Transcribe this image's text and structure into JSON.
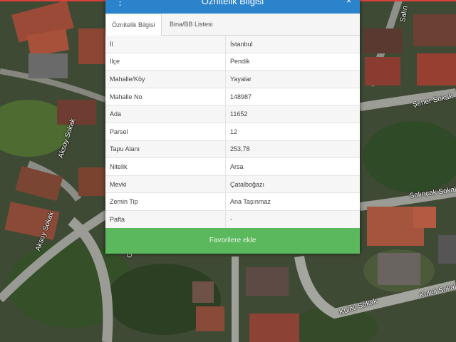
{
  "dialog": {
    "title": "Öznitelik Bilgisi",
    "close": "×",
    "menu": "⋮",
    "tabs": [
      {
        "label": "Öznitelik Bilgisi",
        "active": true
      },
      {
        "label": "Bina/BB Listesi",
        "active": false
      }
    ],
    "rows": [
      {
        "key": "İl",
        "value": "İstanbul"
      },
      {
        "key": "İlçe",
        "value": "Pendik"
      },
      {
        "key": "Mahalle/Köy",
        "value": "Yayalar"
      },
      {
        "key": "Mahalle No",
        "value": "148987"
      },
      {
        "key": "Ada",
        "value": "11652"
      },
      {
        "key": "Parsel",
        "value": "12"
      },
      {
        "key": "Tapu Alanı",
        "value": "253,78"
      },
      {
        "key": "Nitelik",
        "value": "Arsa"
      },
      {
        "key": "Mevki",
        "value": "Çatalboğazı"
      },
      {
        "key": "Zemin Tip",
        "value": "Ana Taşınmaz"
      },
      {
        "key": "Pafta",
        "value": "-"
      }
    ],
    "favorites_button": "Favorilere ekle"
  },
  "map": {
    "street_labels": {
      "aksoy_1": "Aksoy Sokak",
      "aksoy_2": "Aksoy Sokak",
      "sener": "Şener Sokak",
      "salincak": "Salıncak Sokak",
      "kuleli_1": "Kuleli Sokak",
      "kuleli_2": "Kuleli Sokak",
      "salin_top": "Salın",
      "g_bottom": "G"
    }
  },
  "colors": {
    "header": "#2b83cc",
    "button": "#5cb85c",
    "accent_bar": "#d9423a"
  }
}
